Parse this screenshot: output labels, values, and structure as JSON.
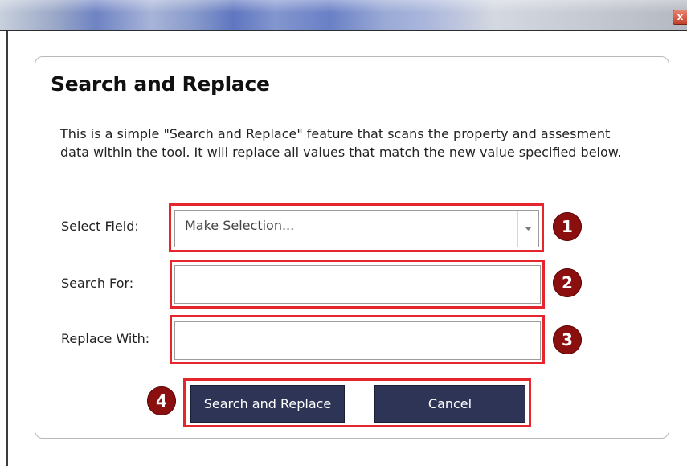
{
  "window": {
    "close_glyph": "x"
  },
  "dialog": {
    "title": "Search and Replace",
    "description": "This is a simple \"Search and Replace\" feature that scans the property and assesment data within the tool. It will replace all values that match the new value specified below.",
    "select_field": {
      "label": "Select Field:",
      "selected": "Make Selection..."
    },
    "search_for": {
      "label": "Search For:",
      "value": ""
    },
    "replace_with": {
      "label": "Replace With:",
      "value": ""
    },
    "buttons": {
      "search_replace": "Search and Replace",
      "cancel": "Cancel"
    }
  },
  "callouts": [
    "1",
    "2",
    "3",
    "4"
  ],
  "colors": {
    "highlight": "#e5262f",
    "badge": "#8b0f0f",
    "button": "#2e3456"
  }
}
